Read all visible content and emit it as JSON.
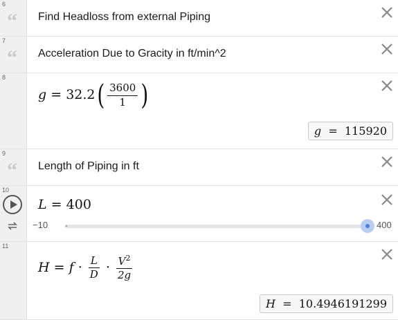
{
  "expressions": [
    {
      "number": "6",
      "text": "Find Headloss from external Piping"
    },
    {
      "number": "7",
      "text": "Acceleration Due to Gracity in ft/min^2"
    },
    {
      "number": "8",
      "lhs": "g",
      "equals": "=",
      "coef": "32.2",
      "num": "3600",
      "den": "1",
      "result": {
        "var": "g",
        "eq": "=",
        "value": "115920"
      }
    },
    {
      "number": "9",
      "text": "Length of Piping in ft"
    },
    {
      "number": "10",
      "lhs": "L",
      "equals": "=",
      "value": "400",
      "slider": {
        "min_label": "−10",
        "max_label": "400",
        "min": -10,
        "max": 400,
        "value": 400
      }
    },
    {
      "number": "11",
      "lhs": "H",
      "equals": "=",
      "f": "f",
      "dot": "·",
      "L": "L",
      "D": "D",
      "V": "V",
      "exp": "2",
      "den2": "2g",
      "result": {
        "var": "H",
        "eq": "=",
        "value": "10.4946191299"
      }
    }
  ],
  "colors": {
    "slider_handle": "#4a7fd6",
    "slider_halo": "#b9cdf3",
    "gutter": "#f0f0f0",
    "quote_mark": "#c9c9c9"
  },
  "icons": [
    "quote-icon",
    "close-icon",
    "play-icon",
    "loop-icon"
  ]
}
